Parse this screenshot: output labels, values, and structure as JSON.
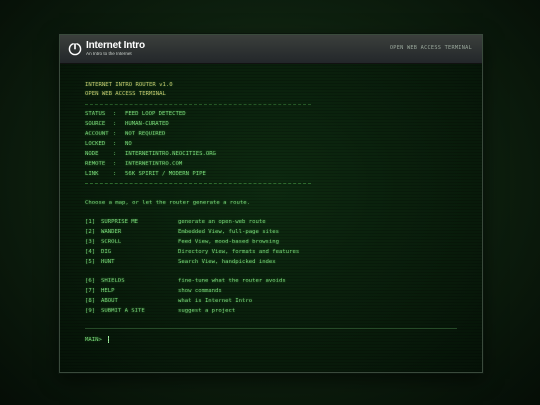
{
  "header": {
    "logo_name": "Internet Intro",
    "logo_tagline": "An Intro to the Internet",
    "subtitle": "OPEN WEB ACCESS TERMINAL"
  },
  "terminal": {
    "banner_title": "INTERNET INTRO ROUTER v1.0",
    "banner_subtitle": "OPEN WEB ACCESS TERMINAL",
    "status_lines": [
      {
        "key": "STATUS",
        "value": "FEED LOOP DETECTED"
      },
      {
        "key": "SOURCE",
        "value": "HUMAN-CURATED"
      },
      {
        "key": "ACCOUNT",
        "value": "NOT REQUIRED"
      },
      {
        "key": "LOCKED",
        "value": "NO"
      },
      {
        "key": "NODE",
        "value": "INTERNETINTRO.NEOCITIES.ORG"
      },
      {
        "key": "REMOTE",
        "value": "INTERNETINTRO.COM"
      },
      {
        "key": "LINK",
        "value": "56K SPIRIT / MODERN PIPE"
      }
    ],
    "prompt_text": "Choose a map, or let the router generate a route.",
    "menu": [
      {
        "num": "[1]",
        "label": "SURPRISE ME",
        "desc": "generate an open-web route"
      },
      {
        "num": "[2]",
        "label": "WANDER",
        "desc": "Embedded View, full-page sites"
      },
      {
        "num": "[3]",
        "label": "SCROLL",
        "desc": "Feed View, mood-based browsing"
      },
      {
        "num": "[4]",
        "label": "DIG",
        "desc": "Directory View, formats and features"
      },
      {
        "num": "[5]",
        "label": "HUNT",
        "desc": "Search View, handpicked index"
      },
      {
        "num": "[6]",
        "label": "SHIELDS",
        "desc": "fine-tune what the router avoids"
      },
      {
        "num": "[7]",
        "label": "HELP",
        "desc": "show commands"
      },
      {
        "num": "[8]",
        "label": "ABOUT",
        "desc": "what is Internet Intro"
      },
      {
        "num": "[9]",
        "label": "SUBMIT A SITE",
        "desc": "suggest a project"
      }
    ],
    "input_prompt": "MAIN>"
  },
  "colors": {
    "terminal_green": "#7cdc7c",
    "banner_yellow": "#c8c870",
    "background": "#07120a"
  },
  "icons": {
    "logo": "power-icon"
  }
}
